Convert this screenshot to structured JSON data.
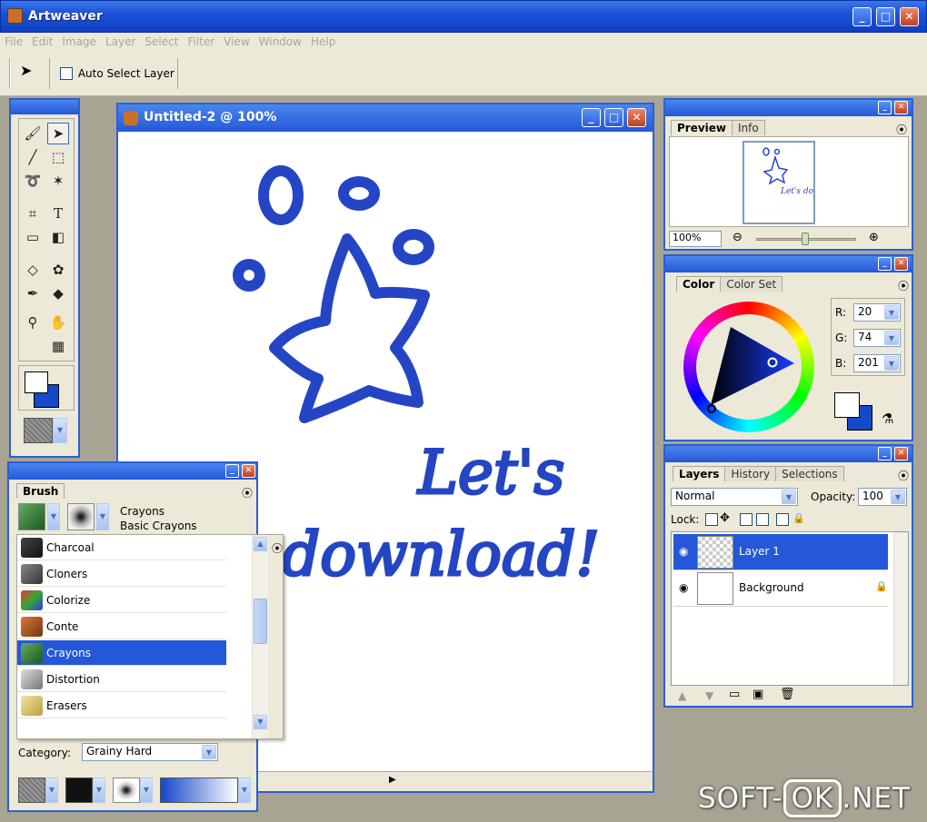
{
  "app": {
    "title": "Artweaver"
  },
  "menu": [
    "File",
    "Edit",
    "Image",
    "Layer",
    "Select",
    "Filter",
    "View",
    "Window",
    "Help"
  ],
  "toolbar": {
    "auto_select_label": "Auto Select Layer"
  },
  "document": {
    "title": "Untitled-2 @ 100%",
    "drawing_text_line1": "Let's",
    "drawing_text_line2": "download!"
  },
  "preview": {
    "tabs": [
      "Preview",
      "Info"
    ],
    "zoom": "100%",
    "thumb_text": "Let's download!"
  },
  "color": {
    "tabs": [
      "Color",
      "Color Set"
    ],
    "r_label": "R:",
    "r": "20",
    "g_label": "G:",
    "g": "74",
    "b_label": "B:",
    "b": "201",
    "fg": "#ffffff",
    "bg": "#144ac9"
  },
  "layers": {
    "tabs": [
      "Layers",
      "History",
      "Selections"
    ],
    "mode": "Normal",
    "opacity_label": "Opacity:",
    "opacity": "100",
    "lock_label": "Lock:",
    "items": [
      {
        "name": "Layer 1"
      },
      {
        "name": "Background"
      }
    ]
  },
  "brush": {
    "title": "Brush",
    "variant_category": "Crayons",
    "variant_name": "Basic Crayons",
    "list": [
      "Charcoal",
      "Cloners",
      "Colorize",
      "Conte",
      "Crayons",
      "Distortion",
      "Erasers"
    ],
    "selected": "Crayons",
    "category_label": "Category:",
    "category": "Grainy Hard"
  },
  "watermark": {
    "left": "SOFT-",
    "box": "OK",
    ".right": ".NET",
    "right": ".NET"
  }
}
